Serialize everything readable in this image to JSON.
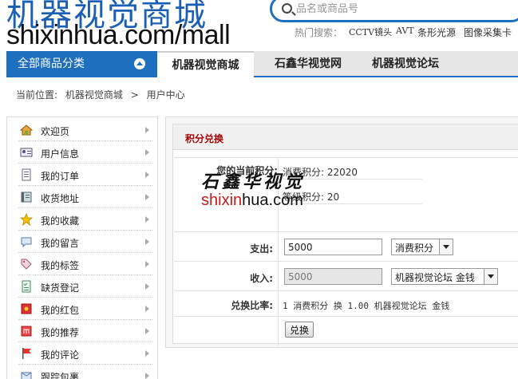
{
  "header": {
    "logo_text": "机器视觉商城",
    "logo_url": "shixinhua.com/mall",
    "search_placeholder": "品名或商品号",
    "hot_label": "热门搜索：",
    "hot_links": [
      "CCTV镜头",
      "AVT",
      "条形光源",
      "图像采集卡"
    ]
  },
  "nav": {
    "category_button": "全部商品分类",
    "tabs": [
      "机器视觉商城",
      "石鑫华视觉网",
      "机器视觉论坛"
    ]
  },
  "breadcrumb": {
    "prefix": "当前位置:",
    "items": [
      "机器视觉商城",
      ">",
      "用户中心"
    ]
  },
  "sidebar": {
    "items": [
      {
        "label": "欢迎页",
        "icon": "home-icon"
      },
      {
        "label": "用户信息",
        "icon": "id-card-icon"
      },
      {
        "label": "我的订单",
        "icon": "document-icon"
      },
      {
        "label": "收货地址",
        "icon": "address-book-icon"
      },
      {
        "label": "我的收藏",
        "icon": "star-icon"
      },
      {
        "label": "我的留言",
        "icon": "speech-bubble-icon"
      },
      {
        "label": "我的标签",
        "icon": "tag-icon"
      },
      {
        "label": "缺货登记",
        "icon": "checklist-icon"
      },
      {
        "label": "我的红包",
        "icon": "red-packet-icon"
      },
      {
        "label": "我的推荐",
        "icon": "recommend-icon"
      },
      {
        "label": "我的评论",
        "icon": "flag-icon"
      },
      {
        "label": "跟踪包裹",
        "icon": "package-icon"
      }
    ]
  },
  "exchange": {
    "title": "积分兑换",
    "current_points_label": "您的当前积分:",
    "consume_points": "消费积分: 22020",
    "rank_points": "等级积分: 20",
    "pay_label": "支出:",
    "pay_value": "5000",
    "pay_currency": "消费积分",
    "income_label": "收入:",
    "income_value": "5000",
    "income_currency": "机器视觉论坛 金钱",
    "rate_label": "兑换比率:",
    "rate_text": "1 消费积分 换 1.00 机器视觉论坛 金钱",
    "submit_label": "兑换"
  },
  "watermark": {
    "cn": "石鑫华视觉",
    "url_red": "shixin",
    "url_dark": "hua.com"
  },
  "colors": {
    "brand_blue": "#1f6fbf",
    "title_red": "#aa0000"
  }
}
